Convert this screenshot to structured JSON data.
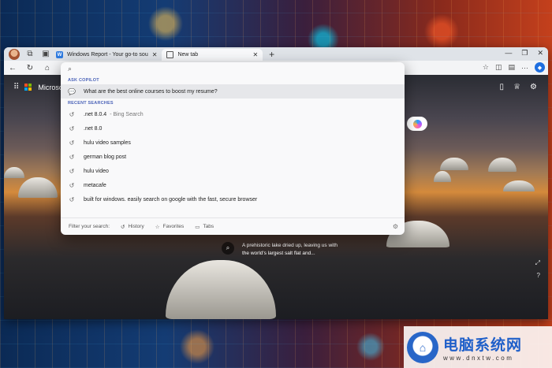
{
  "browser": {
    "tabs": [
      {
        "label": "Windows Report - Your go-to sou",
        "active": false,
        "favicon": "W"
      },
      {
        "label": "New tab",
        "active": true
      }
    ],
    "window_controls": {
      "minimize": "—",
      "maximize": "❐",
      "close": "✕"
    }
  },
  "ntp": {
    "brand": "Microsoft",
    "caption": "A prehistoric lake dried up, leaving us with the world's largest salt flat and..."
  },
  "omnibox": {
    "ask_copilot_header": "ASK COPILOT",
    "copilot_suggestion": "What are the best online courses to boost my resume?",
    "recent_header": "RECENT SEARCHES",
    "recent": [
      {
        "text": ".net 8.0.4",
        "suffix": "- Bing Search"
      },
      {
        "text": ".net 8.0",
        "suffix": ""
      },
      {
        "text": "hulu video samples",
        "suffix": ""
      },
      {
        "text": "german blog post",
        "suffix": ""
      },
      {
        "text": "hulu video",
        "suffix": ""
      },
      {
        "text": "metacafe",
        "suffix": ""
      },
      {
        "text": "built for windows. easily search on google with the fast, secure browser",
        "suffix": ""
      }
    ],
    "footer": {
      "filter_label": "Filter your search:",
      "history": "History",
      "favorites": "Favorites",
      "tabs": "Tabs"
    }
  },
  "watermark": {
    "title": "电脑系统网",
    "url": "www.dnxtw.com"
  }
}
